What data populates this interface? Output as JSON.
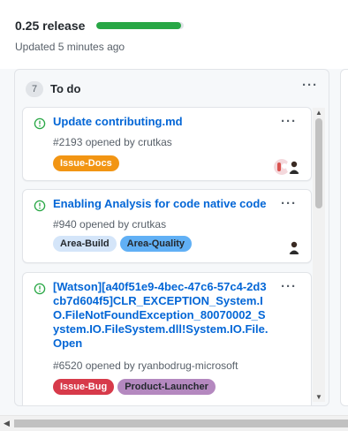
{
  "release": {
    "title": "0.25 release",
    "progress_fraction": 0.97,
    "updated": "Updated 5 minutes ago"
  },
  "column": {
    "name": "To do",
    "count": "7",
    "menu_icon": "kebab-horizontal-icon",
    "cards": [
      {
        "title": "Update contributing.md",
        "meta": "#2193 opened by crutkas",
        "status_icon": "issue-opened-icon",
        "labels": [
          {
            "name": "Issue-Docs",
            "bg": "#f29513",
            "fg": "#ffffff"
          }
        ],
        "avatars": 2
      },
      {
        "title": "Enabling Analysis for code native code",
        "meta": "#940 opened by crutkas",
        "status_icon": "issue-opened-icon",
        "labels": [
          {
            "name": "Area-Build",
            "bg": "#d4e5f9",
            "fg": "#24292e"
          },
          {
            "name": "Area-Quality",
            "bg": "#61b0f5",
            "fg": "#24292e"
          }
        ],
        "avatars": 1
      },
      {
        "title": "[Watson][a40f51e9-4bec-47c6-57c4-2d3cb7d604f5]CLR_EXCEPTION_System.IO.FileNotFoundException_80070002_System.IO.FileSystem.dll!System.IO.File.Open",
        "meta": "#6520 opened by ryanbodrug-microsoft",
        "status_icon": "issue-opened-icon",
        "labels": [
          {
            "name": "Issue-Bug",
            "bg": "#d73a4a",
            "fg": "#ffffff"
          },
          {
            "name": "Product-Launcher",
            "bg": "#b488bf",
            "fg": "#24292e"
          }
        ],
        "avatars": 0
      }
    ]
  },
  "colors": {
    "link": "#0366d6",
    "open_issue": "#28a745",
    "progress": "#28a745"
  }
}
